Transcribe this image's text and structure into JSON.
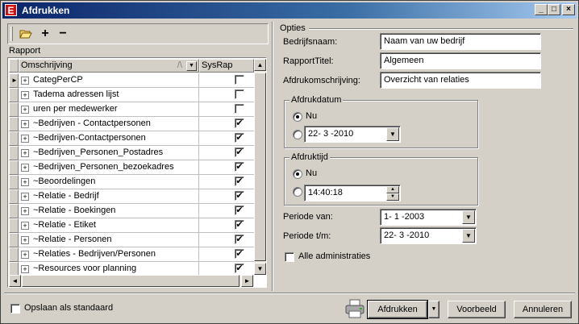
{
  "window": {
    "title": "Afdrukken",
    "app_icon_letter": "E"
  },
  "toolbar": {
    "open_label": "",
    "add_label": "+",
    "remove_label": "−"
  },
  "rapport": {
    "label": "Rapport",
    "col_omschrijving": "Omschrijving",
    "col_sysrap": "SysRap",
    "rows": [
      {
        "name": "CategPerCP",
        "sysrap": false
      },
      {
        "name": "Tadema adressen lijst",
        "sysrap": false
      },
      {
        "name": "uren per medewerker",
        "sysrap": false
      },
      {
        "name": "~Bedrijven - Contactpersonen",
        "sysrap": true
      },
      {
        "name": "~Bedrijven-Contactpersonen",
        "sysrap": true
      },
      {
        "name": "~Bedrijven_Personen_Postadres",
        "sysrap": true
      },
      {
        "name": "~Bedrijven_Personen_bezoekadres",
        "sysrap": true
      },
      {
        "name": "~Beoordelingen",
        "sysrap": true
      },
      {
        "name": "~Relatie - Bedrijf",
        "sysrap": true
      },
      {
        "name": "~Relatie - Boekingen",
        "sysrap": true
      },
      {
        "name": "~Relatie - Etiket",
        "sysrap": true
      },
      {
        "name": "~Relatie - Personen",
        "sysrap": true
      },
      {
        "name": "~Relaties - Bedrijven/Personen",
        "sysrap": true
      },
      {
        "name": "~Resources voor planning",
        "sysrap": true
      }
    ]
  },
  "opties": {
    "label": "Opties",
    "bedrijfsnaam_label": "Bedrijfsnaam:",
    "bedrijfsnaam_value": "Naam van uw bedrijf",
    "rapporttitel_label": "RapportTitel:",
    "rapporttitel_value": "Algemeen",
    "afdrukomschrijving_label": "Afdrukomschrijving:",
    "afdrukomschrijving_value": "Overzicht van relaties",
    "afdrukdatum": {
      "title": "Afdrukdatum",
      "nu_label": "Nu",
      "date_value": "22- 3 -2010"
    },
    "afdruktijd": {
      "title": "Afdruktijd",
      "nu_label": "Nu",
      "time_value": "14:40:18"
    },
    "periode_van_label": "Periode van:",
    "periode_van_value": "1- 1 -2003",
    "periode_tm_label": "Periode t/m:",
    "periode_tm_value": "22- 3 -2010",
    "alle_administraties_label": "Alle administraties"
  },
  "footer": {
    "opslaan_label": "Opslaan als standaard",
    "afdrukken_label": "Afdrukken",
    "voorbeeld_label": "Voorbeeld",
    "annuleren_label": "Annuleren"
  }
}
